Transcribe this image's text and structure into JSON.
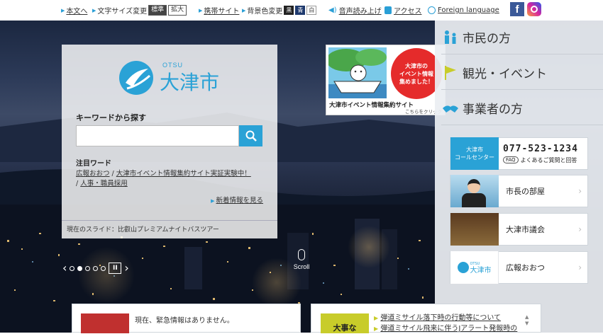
{
  "utility": {
    "skip_label": "本文へ",
    "text_size_label": "文字サイズ変更",
    "size_standard": "標準",
    "size_large": "拡大",
    "mobile_label": "携帯サイト",
    "bg_color_label": "背景色変更",
    "bg_black": "黒",
    "bg_blue": "青",
    "bg_white": "白",
    "speech_label": "音声読み上げ",
    "access_label": "アクセス",
    "foreign_label": "Foreign language"
  },
  "search": {
    "logo_small": "OTSU",
    "logo_text": "大津市",
    "heading": "キーワードから探す",
    "input_value": "",
    "attention_heading": "注目ワード",
    "attention_words": [
      "広報おおつ",
      "大津市イベント情報集約サイト実証実験中！",
      "人事・職員採用"
    ],
    "attention_sep": "/",
    "new_info_link": "新着情報を見る",
    "current_slide": "現在のスライド：比叡山プレミアムナイトバスツアー"
  },
  "banner": {
    "bubble_text": "大津市の\nイベント情報\n集めました！",
    "title": "大津市イベント情報集約サイト",
    "click_label": "こちらをクリック"
  },
  "nav": {
    "citizens": "市民の方",
    "tourism": "観光・イベント",
    "business": "事業者の方"
  },
  "call_center": {
    "name": "大津市\nコールセンター",
    "phone": "077-523-1234",
    "faq_badge": "FAQ",
    "faq_label": "よくあるご質問と回答"
  },
  "side_links": {
    "mayor": "市長の部屋",
    "council": "大津市議会",
    "koho": "広報おおつ",
    "koho_logo": "大津市",
    "koho_logo_small": "OTSU"
  },
  "slider": {
    "prev": "‹",
    "next": "›",
    "pause": "II",
    "scroll_label": "Scroll",
    "active_dot": 1,
    "dot_count": 5
  },
  "emergency": {
    "text": "現在、緊急情報はありません。"
  },
  "important": {
    "badge": "大事な",
    "items": [
      "弾道ミサイル落下時の行動等について",
      "弾道ミサイル飛来に伴うJアラート発報時の"
    ]
  },
  "colors": {
    "accent": "#2aa2d6",
    "dark_nav": "#333333",
    "important_badge": "#c8cc2a",
    "emergency_badge": "#c0302f"
  }
}
